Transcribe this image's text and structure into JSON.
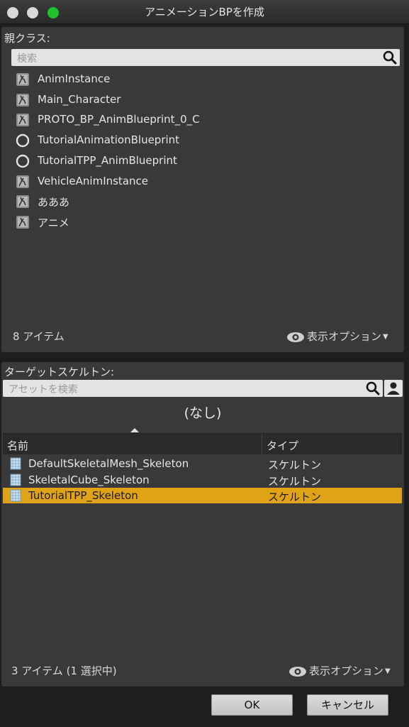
{
  "window": {
    "title": "アニメーションBPを作成"
  },
  "parent_class": {
    "label": "親クラス:",
    "search_placeholder": "検索",
    "items": [
      {
        "label": "AnimInstance",
        "icon": "anim-class-icon"
      },
      {
        "label": "Main_Character",
        "icon": "anim-class-icon"
      },
      {
        "label": "PROTO_BP_AnimBlueprint_0_C",
        "icon": "anim-class-icon"
      },
      {
        "label": "TutorialAnimationBlueprint",
        "icon": "circle-class-icon"
      },
      {
        "label": "TutorialTPP_AnimBlueprint",
        "icon": "circle-class-icon"
      },
      {
        "label": "VehicleAnimInstance",
        "icon": "anim-class-icon"
      },
      {
        "label": "あああ",
        "icon": "anim-class-icon"
      },
      {
        "label": "アニメ",
        "icon": "anim-class-icon"
      }
    ],
    "count": "8 アイテム",
    "view_options": "表示オプション"
  },
  "target_skeleton": {
    "label": "ターゲットスケルトン:",
    "search_placeholder": "アセットを検索",
    "none_label": "(なし)",
    "columns": {
      "name": "名前",
      "type": "タイプ"
    },
    "rows": [
      {
        "name": "DefaultSkeletalMesh_Skeleton",
        "type": "スケルトン",
        "selected": false
      },
      {
        "name": "SkeletalCube_Skeleton",
        "type": "スケルトン",
        "selected": false
      },
      {
        "name": "TutorialTPP_Skeleton",
        "type": "スケルトン",
        "selected": true
      }
    ],
    "count": "3 アイテム (1 選択中)",
    "view_options": "表示オプション"
  },
  "buttons": {
    "ok": "OK",
    "cancel": "キャンセル"
  },
  "colors": {
    "accent": "#e0a316",
    "maximize": "#1fc12f"
  }
}
